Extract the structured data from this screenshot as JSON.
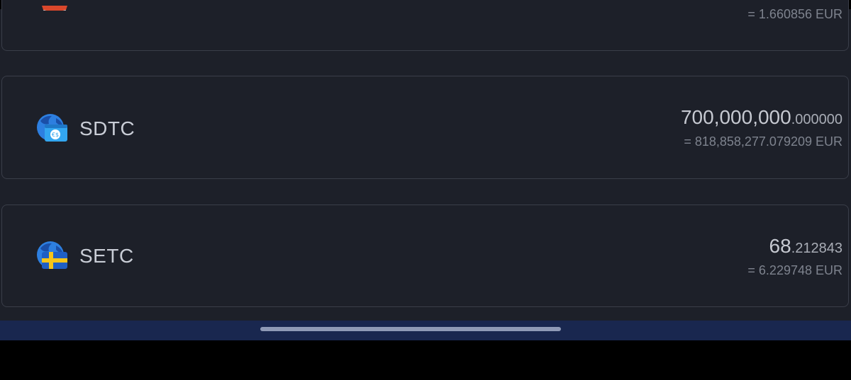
{
  "partial_row": {
    "eur_value": "= 1.660856 EUR",
    "icon": "token-icon-red"
  },
  "tokens": [
    {
      "name": "SDTC",
      "amount_int": "700,000,000",
      "amount_dec": ".000000",
      "eur_value": "= 818,858,277.079209 EUR",
      "icon": "globe-stablecoin-icon"
    },
    {
      "name": "SETC",
      "amount_int": "68",
      "amount_dec": ".212843",
      "eur_value": "= 6.229748 EUR",
      "icon": "globe-sweden-flag-icon"
    }
  ],
  "colors": {
    "background": "#1d2029",
    "card_border": "#3a3e49",
    "bottom_bar": "#19274f",
    "globe_blue": "#2d7fe0"
  }
}
